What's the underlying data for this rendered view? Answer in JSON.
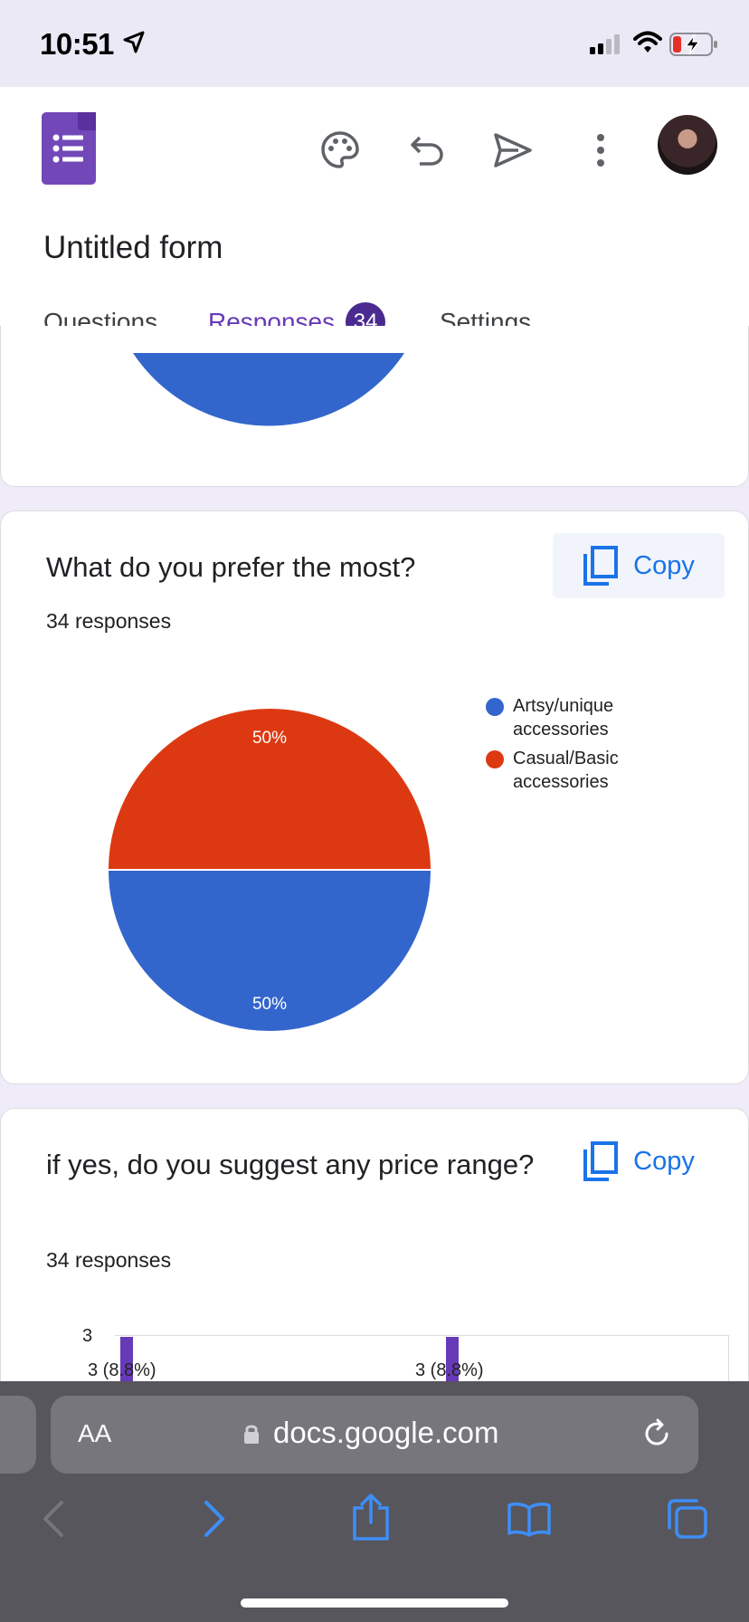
{
  "status_bar": {
    "time": "10:51"
  },
  "header": {
    "form_title": "Untitled form",
    "tabs": [
      {
        "label": "Questions"
      },
      {
        "label": "Responses",
        "badge": "34"
      },
      {
        "label": "Settings"
      }
    ]
  },
  "cards": [
    {
      "question": "What do you prefer the most?",
      "responses": "34 responses",
      "copy_label": "Copy",
      "chart_data": {
        "type": "pie",
        "slices": [
          {
            "label": "Artsy/unique accessories",
            "value": 50,
            "display": "50%",
            "color": "#3366cc"
          },
          {
            "label": "Casual/Basic accessories",
            "value": 50,
            "display": "50%",
            "color": "#dc3912"
          }
        ]
      },
      "legend": [
        "Artsy/unique",
        "accessories",
        "Casual/Basic",
        "accessories"
      ]
    },
    {
      "question": "if yes, do you suggest any price range?",
      "responses": "34 responses",
      "copy_label": "Copy",
      "chart_data": {
        "type": "bar",
        "y_tick": "3",
        "data_labels": [
          "3 (8.8%)",
          "3 (8.8%)"
        ]
      }
    }
  ],
  "safari": {
    "text_size_label": "AA",
    "url": "docs.google.com"
  },
  "colors": {
    "accent": "#673ab7",
    "copy_blue": "#1a73e8",
    "pie_blue": "#3366cc",
    "pie_red": "#dc3912"
  }
}
